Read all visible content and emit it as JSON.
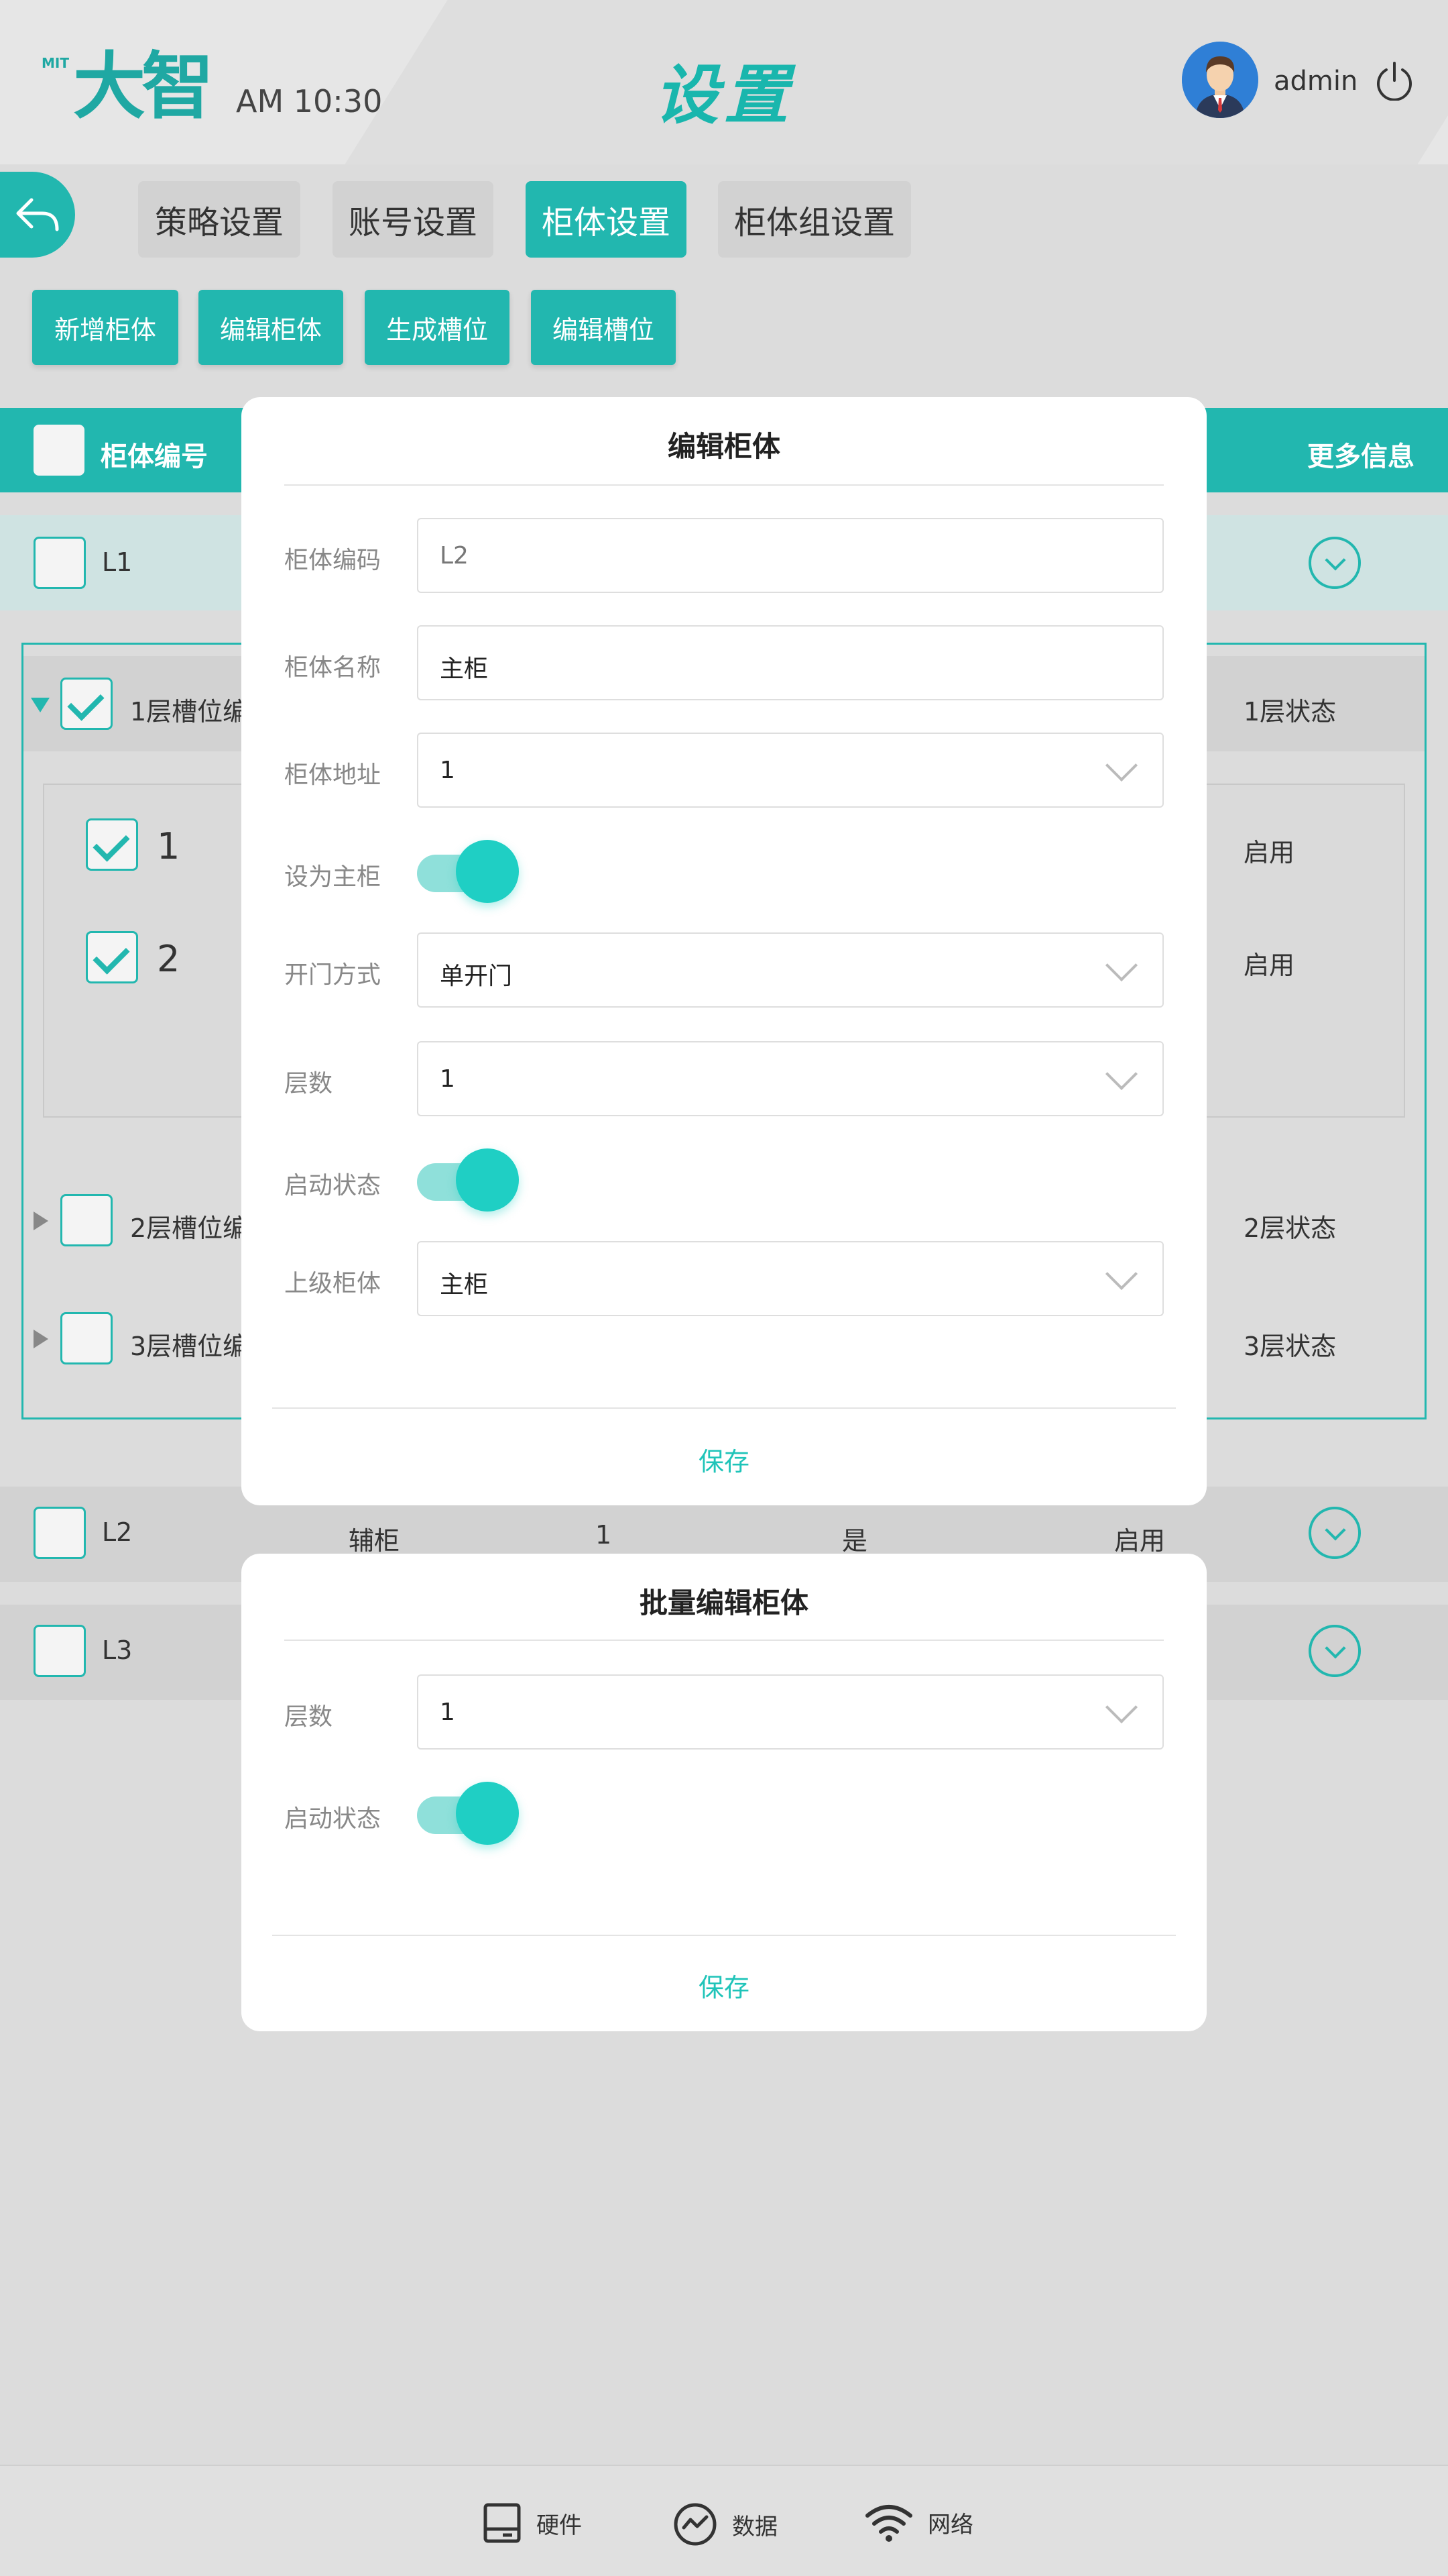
{
  "header": {
    "logo_small": "MIT",
    "logo_text": "大智",
    "time": "AM 10:30",
    "title": "设置",
    "username": "admin"
  },
  "tabs": [
    {
      "label": "策略设置",
      "active": false
    },
    {
      "label": "账号设置",
      "active": false
    },
    {
      "label": "柜体设置",
      "active": true
    },
    {
      "label": "柜体组设置",
      "active": false
    }
  ],
  "actions": [
    "新增柜体",
    "编辑柜体",
    "生成槽位",
    "编辑槽位"
  ],
  "table": {
    "header_id": "柜体编号",
    "header_more": "更多信息",
    "rows": [
      {
        "id": "L1"
      },
      {
        "id": "L2",
        "name": "辅柜",
        "layers": "1",
        "is_main": "是",
        "status": "启用"
      },
      {
        "id": "L3"
      }
    ],
    "expanded": {
      "layers": [
        {
          "label": "1层槽位编",
          "status": "1层状态"
        },
        {
          "label": "2层槽位编",
          "status": "2层状态"
        },
        {
          "label": "3层槽位编",
          "status": "3层状态"
        }
      ],
      "slots": [
        {
          "number": "1",
          "status": "启用"
        },
        {
          "number": "2",
          "status": "启用"
        }
      ]
    }
  },
  "edit_modal": {
    "title": "编辑柜体",
    "fields": {
      "code": {
        "label": "柜体编码",
        "value": "L2"
      },
      "name": {
        "label": "柜体名称",
        "value": "主柜"
      },
      "address": {
        "label": "柜体地址",
        "value": "1"
      },
      "main": {
        "label": "设为主柜",
        "on": true
      },
      "door": {
        "label": "开门方式",
        "value": "单开门"
      },
      "layers": {
        "label": "层数",
        "value": "1"
      },
      "status": {
        "label": "启动状态",
        "on": true
      },
      "parent": {
        "label": "上级柜体",
        "value": "主柜"
      }
    },
    "save": "保存"
  },
  "batch_modal": {
    "title": "批量编辑柜体",
    "fields": {
      "layers": {
        "label": "层数",
        "value": "1"
      },
      "status": {
        "label": "启动状态",
        "on": true
      }
    },
    "save": "保存"
  },
  "footer": {
    "items": [
      {
        "label": "硬件",
        "icon": "hardware-icon"
      },
      {
        "label": "数据",
        "icon": "data-icon"
      },
      {
        "label": "网络",
        "icon": "wifi-icon"
      }
    ]
  },
  "colors": {
    "accent": "#22b7af",
    "toggle": "#1fcfc4",
    "save": "#1fc4b9"
  }
}
